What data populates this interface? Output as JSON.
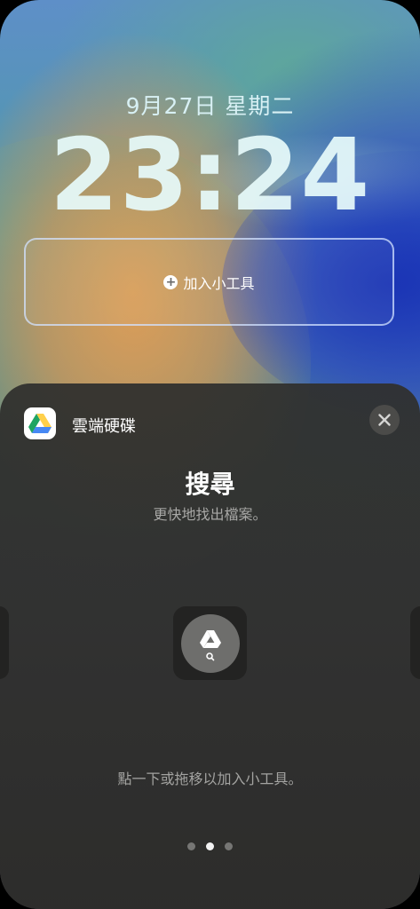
{
  "lockscreen": {
    "date": "9月27日 星期二",
    "time": "23:24",
    "add_widget_label": "加入小工具"
  },
  "sheet": {
    "app_name": "雲端硬碟",
    "app_icon": "google-drive-icon",
    "widget_title": "搜尋",
    "widget_subtitle": "更快地找出檔案。",
    "hint": "點一下或拖移以加入小工具。",
    "page_count": 3,
    "active_page": 2
  },
  "colors": {
    "sheet_bg": "#2e2e2c",
    "accent_white": "#ffffff",
    "secondary_text": "#a8a8a6",
    "drive_green": "#1fa463",
    "drive_yellow": "#ffd04b",
    "drive_blue": "#4688f4"
  }
}
